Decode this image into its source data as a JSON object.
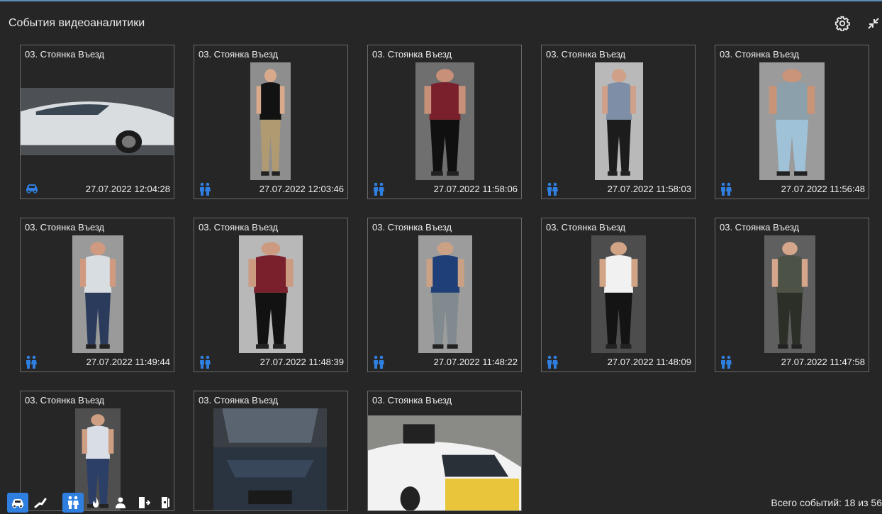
{
  "window": {
    "title": "События видеоаналитики"
  },
  "colors": {
    "accent": "#2f7fe0",
    "background": "#262626",
    "border": "#6a6a6a"
  },
  "toolbar": {
    "settings_icon": "gear-icon",
    "collapse_icon": "collapse-icon"
  },
  "events": [
    {
      "camera": "03. Стоянка Въезд",
      "time": "27.07.2022 12:04:28",
      "type": "car-icon"
    },
    {
      "camera": "03. Стоянка Въезд",
      "time": "27.07.2022 12:03:46",
      "type": "people-icon"
    },
    {
      "camera": "03. Стоянка Въезд",
      "time": "27.07.2022 11:58:06",
      "type": "people-icon"
    },
    {
      "camera": "03. Стоянка Въезд",
      "time": "27.07.2022 11:58:03",
      "type": "people-icon"
    },
    {
      "camera": "03. Стоянка Въезд",
      "time": "27.07.2022 11:56:48",
      "type": "people-icon"
    },
    {
      "camera": "03. Стоянка Въезд",
      "time": "27.07.2022 11:49:44",
      "type": "people-icon"
    },
    {
      "camera": "03. Стоянка Въезд",
      "time": "27.07.2022 11:48:39",
      "type": "people-icon"
    },
    {
      "camera": "03. Стоянка Въезд",
      "time": "27.07.2022 11:48:22",
      "type": "people-icon"
    },
    {
      "camera": "03. Стоянка Въезд",
      "time": "27.07.2022 11:48:09",
      "type": "people-icon"
    },
    {
      "camera": "03. Стоянка Въезд",
      "time": "27.07.2022 11:47:58",
      "type": "people-icon"
    },
    {
      "camera": "03. Стоянка Въезд",
      "time": "",
      "type": ""
    },
    {
      "camera": "03. Стоянка Въезд",
      "time": "",
      "type": ""
    },
    {
      "camera": "03. Стоянка Въезд",
      "time": "",
      "type": ""
    }
  ],
  "filters": [
    {
      "icon": "car-icon",
      "active": true
    },
    {
      "icon": "line-crossing-icon",
      "active": false
    },
    {
      "icon": "people-icon",
      "active": true
    },
    {
      "icon": "fire-icon",
      "active": false
    },
    {
      "icon": "person-icon",
      "active": false
    },
    {
      "icon": "enter-door-icon",
      "active": false
    },
    {
      "icon": "exit-door-icon",
      "active": false
    }
  ],
  "status": {
    "total": "Всего событий: 18 из 56"
  }
}
